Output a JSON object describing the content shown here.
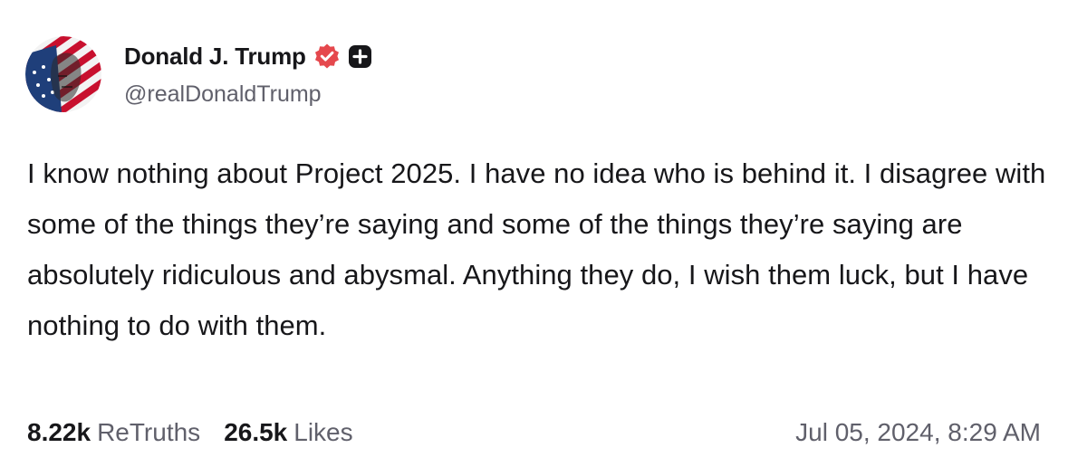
{
  "post": {
    "author": {
      "display_name": "Donald J. Trump",
      "handle": "@realDonaldTrump",
      "verified_badge_icon": "verified-badge-icon",
      "plus_icon": "plus-badge-icon",
      "badge_color": "#e5484d"
    },
    "text": "I know nothing about Project 2025. I have no idea who is behind it. I disagree with some of the things they’re saying and some of the things they’re saying are absolutely ridiculous and abysmal. Anything they do, I wish them luck, but I have nothing to do with them.",
    "stats": {
      "retruths_count": "8.22k",
      "retruths_label": "ReTruths",
      "likes_count": "26.5k",
      "likes_label": "Likes"
    },
    "timestamp": "Jul 05, 2024, 8:29 AM"
  }
}
